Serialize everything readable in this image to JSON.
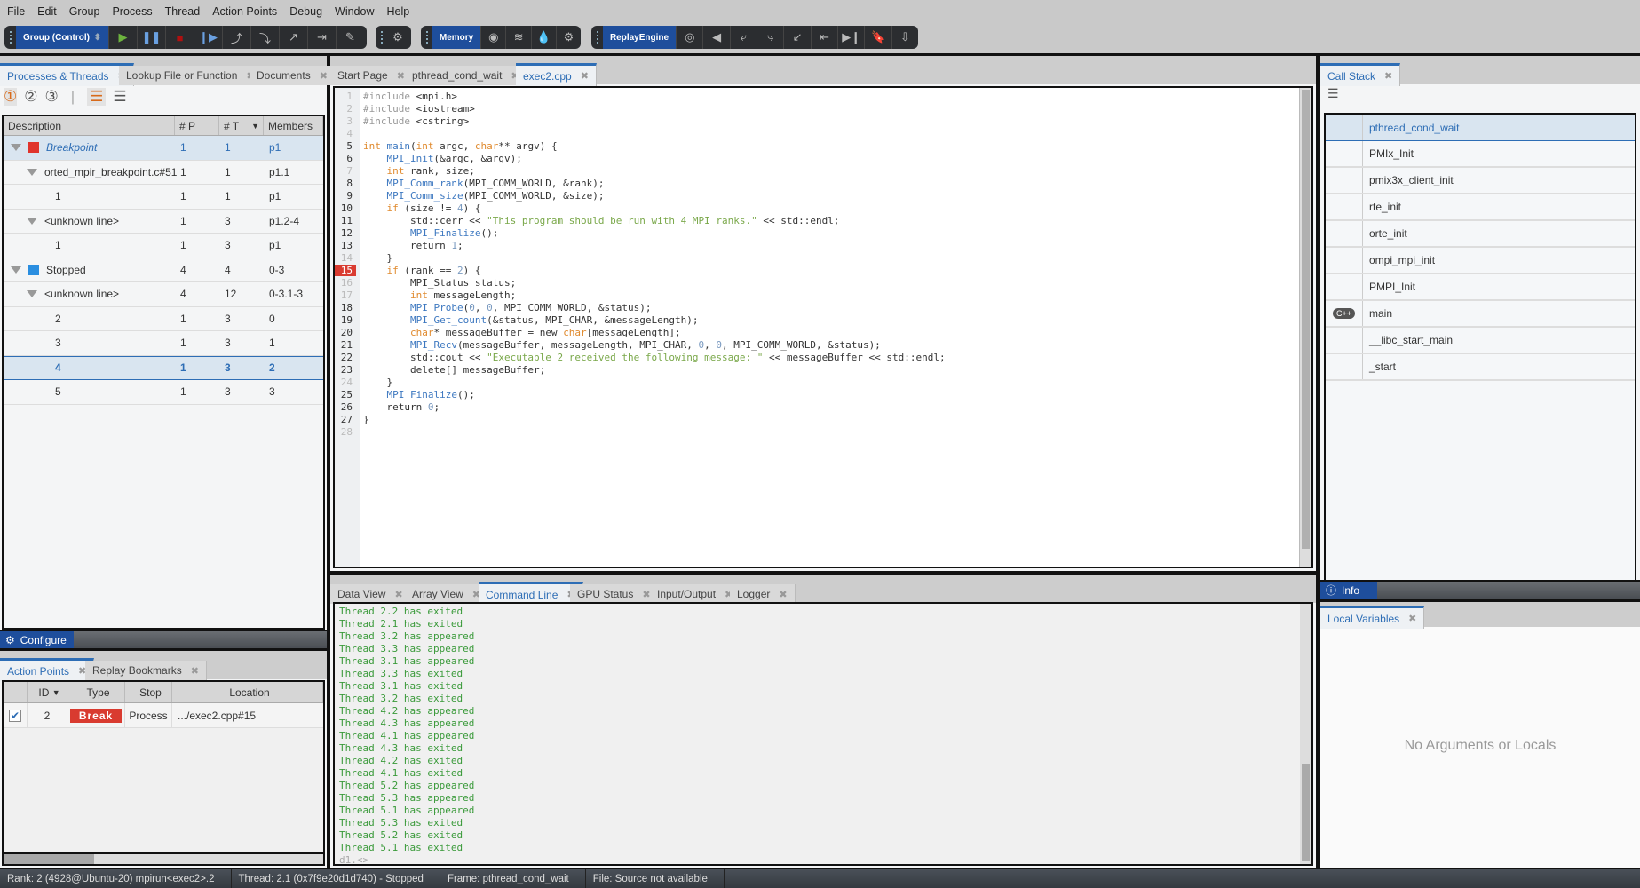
{
  "menu": [
    "File",
    "Edit",
    "Group",
    "Process",
    "Thread",
    "Action Points",
    "Debug",
    "Window",
    "Help"
  ],
  "toolbar": {
    "group_select": "Group (Control)",
    "memory": "Memory",
    "replay": "ReplayEngine"
  },
  "left": {
    "tabs": [
      "Processes & Threads",
      "Lookup File or Function",
      "Documents"
    ],
    "columns": [
      "Description",
      "# P",
      "# T",
      "Members"
    ],
    "rows": [
      {
        "level": 0,
        "expand": true,
        "swatch": "#e0342c",
        "desc": "Breakpoint",
        "p": "1",
        "t": "1",
        "m": "p1",
        "sel": "cell"
      },
      {
        "level": 1,
        "expand": true,
        "desc": "orted_mpir_breakpoint.c#51",
        "p": "1",
        "t": "1",
        "m": "p1.1"
      },
      {
        "level": 2,
        "desc": "1",
        "p": "1",
        "t": "1",
        "m": "p1"
      },
      {
        "level": 1,
        "expand": true,
        "desc": "<unknown line>",
        "p": "1",
        "t": "3",
        "m": "p1.2-4"
      },
      {
        "level": 2,
        "desc": "1",
        "p": "1",
        "t": "3",
        "m": "p1"
      },
      {
        "level": 0,
        "expand": true,
        "swatch": "#2a8ee0",
        "desc": "Stopped",
        "p": "4",
        "t": "4",
        "m": "0-3"
      },
      {
        "level": 1,
        "expand": true,
        "desc": "<unknown line>",
        "p": "4",
        "t": "12",
        "m": "0-3.1-3"
      },
      {
        "level": 2,
        "desc": "2",
        "p": "1",
        "t": "3",
        "m": "0"
      },
      {
        "level": 2,
        "desc": "3",
        "p": "1",
        "t": "3",
        "m": "1"
      },
      {
        "level": 2,
        "desc": "4",
        "p": "1",
        "t": "3",
        "m": "2",
        "sel": "row"
      },
      {
        "level": 2,
        "desc": "5",
        "p": "1",
        "t": "3",
        "m": "3"
      }
    ],
    "configure": "Configure"
  },
  "actionpoints": {
    "tabs": [
      "Action Points",
      "Replay Bookmarks"
    ],
    "columns": [
      "ID",
      "Type",
      "Stop",
      "Location"
    ],
    "rows": [
      {
        "checked": true,
        "id": "2",
        "type": "Break",
        "stop": "Process",
        "location": ".../exec2.cpp#15"
      }
    ]
  },
  "editor": {
    "tabs": [
      "Start Page",
      "pthread_cond_wait",
      "exec2.cpp"
    ],
    "active_tab": 2,
    "breakpoint_line": 15,
    "lines": [
      "#include <mpi.h>",
      "#include <iostream>",
      "#include <cstring>",
      "",
      "int main(int argc, char** argv) {",
      "    MPI_Init(&argc, &argv);",
      "    int rank, size;",
      "    MPI_Comm_rank(MPI_COMM_WORLD, &rank);",
      "    MPI_Comm_size(MPI_COMM_WORLD, &size);",
      "    if (size != 4) {",
      "        std::cerr << \"This program should be run with 4 MPI ranks.\" << std::endl;",
      "        MPI_Finalize();",
      "        return 1;",
      "    }",
      "    if (rank == 2) {",
      "        MPI_Status status;",
      "        int messageLength;",
      "        MPI_Probe(0, 0, MPI_COMM_WORLD, &status);",
      "        MPI_Get_count(&status, MPI_CHAR, &messageLength);",
      "        char* messageBuffer = new char[messageLength];",
      "        MPI_Recv(messageBuffer, messageLength, MPI_CHAR, 0, 0, MPI_COMM_WORLD, &status);",
      "        std::cout << \"Executable 2 received the following message: \" << messageBuffer << std::endl;",
      "        delete[] messageBuffer;",
      "    }",
      "    MPI_Finalize();",
      "    return 0;",
      "}",
      ""
    ],
    "dim_lines": [
      1,
      2,
      3,
      4,
      7,
      14,
      16,
      17,
      24,
      28
    ]
  },
  "bottom": {
    "tabs": [
      "Data View",
      "Array View",
      "Command Line",
      "GPU Status",
      "Input/Output",
      "Logger"
    ],
    "active_tab": 2,
    "console": [
      "Thread 2.2 has exited",
      "Thread 2.1 has exited",
      "Thread 3.2 has appeared",
      "Thread 3.3 has appeared",
      "Thread 3.1 has appeared",
      "Thread 3.3 has exited",
      "Thread 3.1 has exited",
      "Thread 3.2 has exited",
      "Thread 4.2 has appeared",
      "Thread 4.3 has appeared",
      "Thread 4.1 has appeared",
      "Thread 4.3 has exited",
      "Thread 4.2 has exited",
      "Thread 4.1 has exited",
      "Thread 5.2 has appeared",
      "Thread 5.3 has appeared",
      "Thread 5.1 has appeared",
      "Thread 5.3 has exited",
      "Thread 5.2 has exited",
      "Thread 5.1 has exited"
    ],
    "prompt": "d1.<>"
  },
  "callstack": {
    "tab": "Call Stack",
    "frames": [
      {
        "name": "pthread_cond_wait",
        "sel": true
      },
      {
        "name": "PMIx_Init"
      },
      {
        "name": "pmix3x_client_init"
      },
      {
        "name": "rte_init"
      },
      {
        "name": "orte_init"
      },
      {
        "name": "ompi_mpi_init"
      },
      {
        "name": "PMPI_Init"
      },
      {
        "name": "main",
        "lang": "C++"
      },
      {
        "name": "__libc_start_main"
      },
      {
        "name": "_start"
      }
    ],
    "info": "Info"
  },
  "locals": {
    "tab": "Local Variables",
    "empty": "No Arguments or Locals"
  },
  "status": [
    "Rank: 2 (4928@Ubuntu-20) mpirun<exec2>.2",
    "Thread: 2.1 (0x7f9e20d1d740) - Stopped",
    "Frame: pthread_cond_wait",
    "File: Source not available"
  ],
  "colors": {
    "accent": "#2d6db5",
    "breakpoint": "#d93b30",
    "console_text": "#3a9a3a",
    "toolbar_select": "#1e4e9c"
  }
}
